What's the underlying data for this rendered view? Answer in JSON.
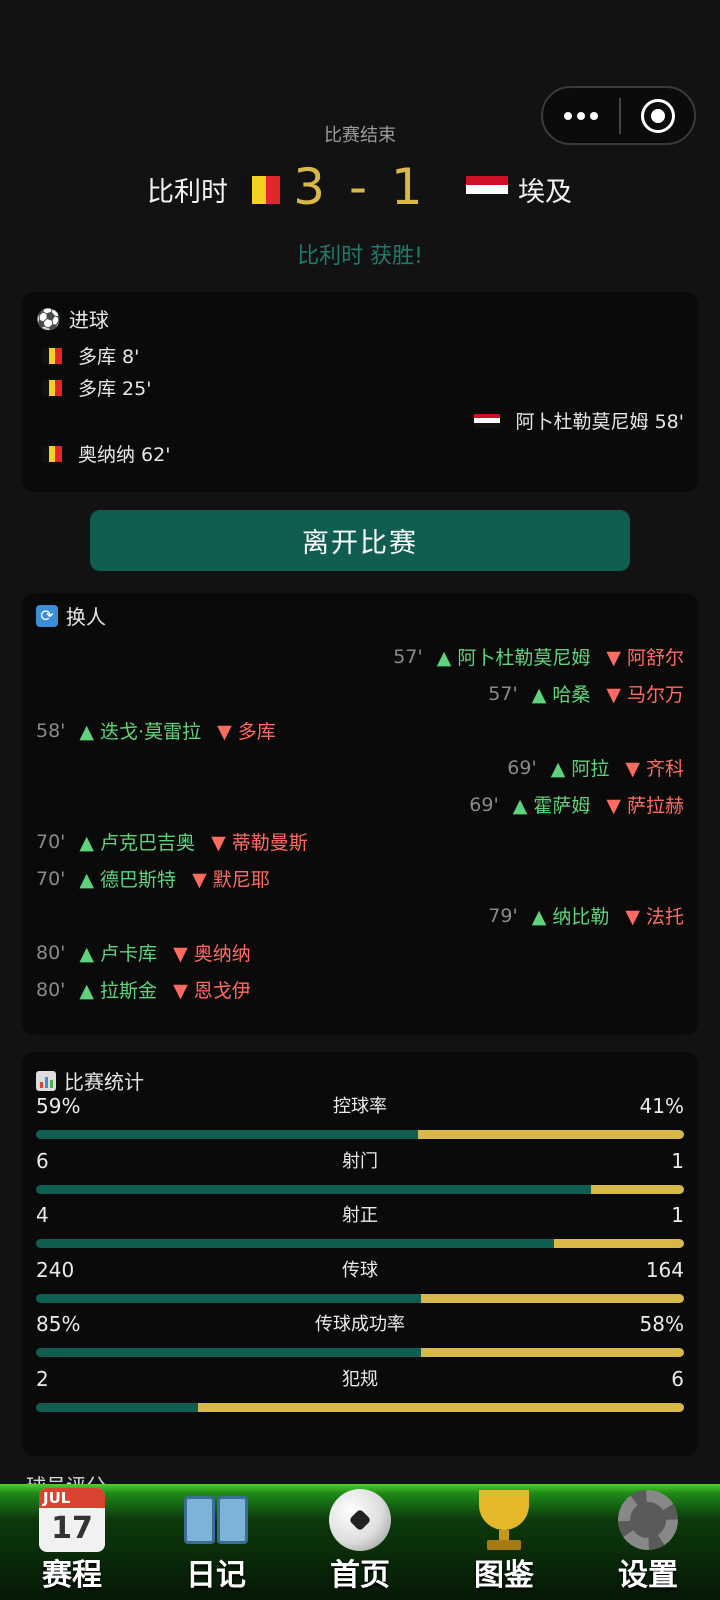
{
  "match": {
    "status": "比赛结束",
    "home_team": "比利时",
    "away_team": "埃及",
    "score": "3 - 1",
    "result_text": "比利时 获胜!"
  },
  "goals": {
    "icon": "soccer-ball-icon",
    "title": "进球",
    "items": [
      {
        "side": "home",
        "text": "多库 8'"
      },
      {
        "side": "home",
        "text": "多库 25'"
      },
      {
        "side": "away",
        "text": "阿卜杜勒莫尼姆 58'"
      },
      {
        "side": "home",
        "text": "奥纳纳 62'"
      }
    ]
  },
  "leave_button": "离开比赛",
  "substitutions": {
    "icon": "refresh-icon",
    "title": "换人",
    "items": [
      {
        "side": "away",
        "minute": "57'",
        "in": "▲ 阿卜杜勒莫尼姆",
        "out": "▼ 阿舒尔"
      },
      {
        "side": "away",
        "minute": "57'",
        "in": "▲ 哈桑",
        "out": "▼ 马尔万"
      },
      {
        "side": "home",
        "minute": "58'",
        "in": "▲ 迭戈·莫雷拉",
        "out": "▼ 多库"
      },
      {
        "side": "away",
        "minute": "69'",
        "in": "▲ 阿拉",
        "out": "▼ 齐科"
      },
      {
        "side": "away",
        "minute": "69'",
        "in": "▲ 霍萨姆",
        "out": "▼ 萨拉赫"
      },
      {
        "side": "home",
        "minute": "70'",
        "in": "▲ 卢克巴吉奥",
        "out": "▼ 蒂勒曼斯"
      },
      {
        "side": "home",
        "minute": "70'",
        "in": "▲ 德巴斯特",
        "out": "▼ 默尼耶"
      },
      {
        "side": "away",
        "minute": "79'",
        "in": "▲ 纳比勒",
        "out": "▼ 法托"
      },
      {
        "side": "home",
        "minute": "80'",
        "in": "▲ 卢卡库",
        "out": "▼ 奥纳纳"
      },
      {
        "side": "home",
        "minute": "80'",
        "in": "▲ 拉斯金",
        "out": "▼ 恩戈伊"
      }
    ]
  },
  "stats": {
    "icon": "bar-chart-icon",
    "title": "比赛统计",
    "items": [
      {
        "name": "控球率",
        "home": "59%",
        "away": "41%",
        "home_share": 0.59
      },
      {
        "name": "射门",
        "home": "6",
        "away": "1",
        "home_share": 0.857
      },
      {
        "name": "射正",
        "home": "4",
        "away": "1",
        "home_share": 0.8
      },
      {
        "name": "传球",
        "home": "240",
        "away": "164",
        "home_share": 0.594
      },
      {
        "name": "传球成功率",
        "home": "85%",
        "away": "58%",
        "home_share": 0.594
      },
      {
        "name": "犯规",
        "home": "2",
        "away": "6",
        "home_share": 0.25
      }
    ]
  },
  "next_section_title": "球员评分",
  "tabbar": {
    "items": [
      {
        "label": "赛程",
        "icon": "calendar-icon"
      },
      {
        "label": "日记",
        "icon": "book-icon"
      },
      {
        "label": "首页",
        "icon": "soccer-ball-icon"
      },
      {
        "label": "图鉴",
        "icon": "trophy-icon"
      },
      {
        "label": "设置",
        "icon": "gear-icon"
      }
    ],
    "calendar_month": "JUL",
    "calendar_day": "17"
  },
  "colors": {
    "home_bar": "#0f5e51",
    "away_bar": "#d9b84a",
    "sub_in": "#5fd37b",
    "sub_out": "#ff6b62",
    "score": "#d9b84a"
  }
}
